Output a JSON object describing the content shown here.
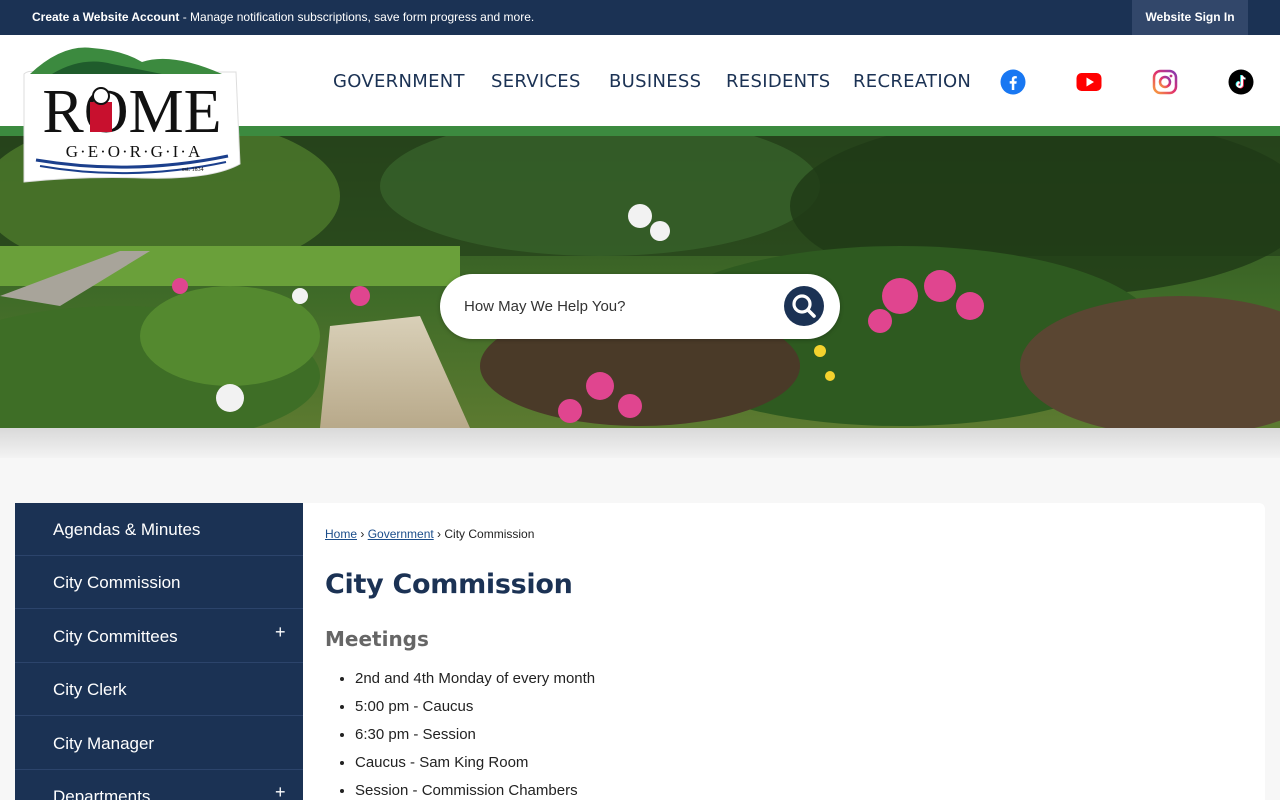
{
  "topbar": {
    "promo_bold": "Create a Website Account",
    "promo_rest": " - Manage notification subscriptions, save form progress and more.",
    "signin": "Website Sign In"
  },
  "nav": {
    "items": [
      "GOVERNMENT",
      "SERVICES",
      "BUSINESS",
      "RESIDENTS",
      "RECREATION"
    ],
    "social": [
      "facebook-icon",
      "youtube-icon",
      "instagram-icon",
      "tiktok-icon"
    ]
  },
  "logo": {
    "line1": "ROME",
    "line2": "G·E·O·R·G·I·A",
    "est": "est. 1834"
  },
  "search": {
    "placeholder": "How May We Help You?"
  },
  "sidebar": {
    "items": [
      {
        "label": "Agendas & Minutes",
        "expand": ""
      },
      {
        "label": "City Commission",
        "expand": ""
      },
      {
        "label": "City Committees",
        "expand": "+"
      },
      {
        "label": "City Clerk",
        "expand": ""
      },
      {
        "label": "City Manager",
        "expand": ""
      },
      {
        "label": "Departments",
        "expand": "+"
      }
    ]
  },
  "breadcrumb": {
    "home": "Home",
    "sep1": " › ",
    "gov": "Government",
    "sep2": " › ",
    "current": "City Commission"
  },
  "main": {
    "title": "City Commission",
    "subtitle": "Meetings",
    "list": [
      "2nd and 4th Monday of every month",
      "5:00 pm - Caucus",
      "6:30 pm - Session",
      "Caucus - Sam King Room",
      "Session - Commission Chambers"
    ]
  },
  "colors": {
    "navy": "#1b3254",
    "green": "#3c8a3f",
    "facebook": "#1877f2",
    "youtube": "#ff0000"
  }
}
